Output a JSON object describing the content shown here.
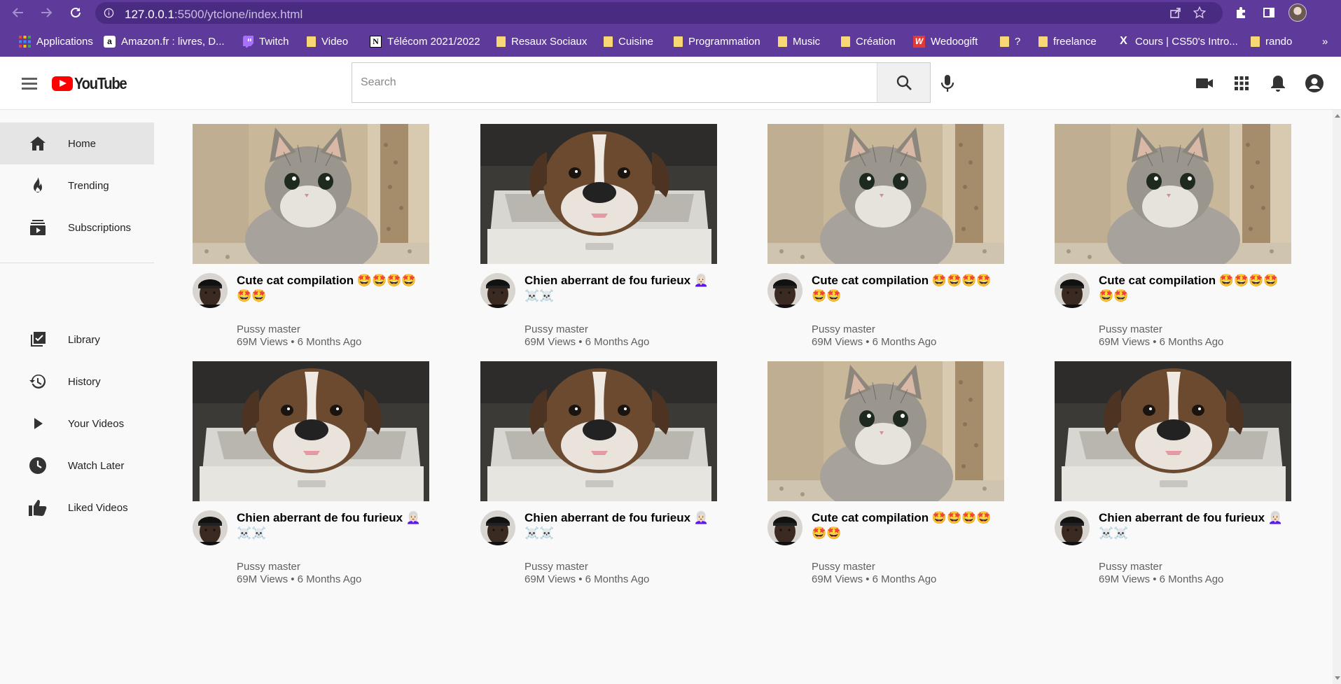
{
  "browser": {
    "url_host": "127.0.0.1",
    "url_rest": ":5500/ytclone/index.html",
    "bookmarks": [
      {
        "label": "Applications",
        "icon": "apps-grid-icon"
      },
      {
        "label": "Amazon.fr : livres, D...",
        "icon": "amazon-icon"
      },
      {
        "label": "Twitch",
        "icon": "twitch-icon"
      },
      {
        "label": "Video",
        "icon": "folder-icon"
      },
      {
        "label": "Télécom 2021/2022",
        "icon": "notion-icon"
      },
      {
        "label": "Resaux Sociaux",
        "icon": "folder-icon"
      },
      {
        "label": "Cuisine",
        "icon": "folder-icon"
      },
      {
        "label": "Programmation",
        "icon": "folder-icon"
      },
      {
        "label": "Music",
        "icon": "folder-icon"
      },
      {
        "label": "Création",
        "icon": "folder-icon"
      },
      {
        "label": "Wedoogift",
        "icon": "wedoogift-icon"
      },
      {
        "label": "?",
        "icon": "folder-icon"
      },
      {
        "label": "freelance",
        "icon": "folder-icon"
      },
      {
        "label": "Cours | CS50's Intro...",
        "icon": "edx-icon"
      },
      {
        "label": "rando",
        "icon": "folder-icon"
      }
    ],
    "more_label": "»"
  },
  "header": {
    "logo_text": "YouTube",
    "search_placeholder": "Search"
  },
  "sidebar": {
    "items": [
      {
        "label": "Home",
        "icon": "home-icon",
        "active": true
      },
      {
        "label": "Trending",
        "icon": "flame-icon"
      },
      {
        "label": "Subscriptions",
        "icon": "subscriptions-icon"
      },
      {
        "label": "Library",
        "icon": "library-icon"
      },
      {
        "label": "History",
        "icon": "history-icon"
      },
      {
        "label": "Your Videos",
        "icon": "play-icon"
      },
      {
        "label": "Watch Later",
        "icon": "clock-icon"
      },
      {
        "label": "Liked Videos",
        "icon": "thumbs-up-icon"
      }
    ]
  },
  "videos": [
    {
      "title": "Cute cat compilation 🤩🤩🤩🤩🤩🤩",
      "thumb": "cat",
      "channel": "Pussy master",
      "meta": "69M Views • 6 Months Ago"
    },
    {
      "title": "Chien aberrant de fou furieux 👩🏻‍🦳☠️☠️",
      "thumb": "dog",
      "channel": "Pussy master",
      "meta": "69M Views • 6 Months Ago"
    },
    {
      "title": "Cute cat compilation 🤩🤩🤩🤩🤩🤩",
      "thumb": "cat",
      "channel": "Pussy master",
      "meta": "69M Views • 6 Months Ago"
    },
    {
      "title": "Cute cat compilation 🤩🤩🤩🤩🤩🤩",
      "thumb": "cat",
      "channel": "Pussy master",
      "meta": "69M Views • 6 Months Ago"
    },
    {
      "title": "Chien aberrant de fou furieux 👩🏻‍🦳☠️☠️",
      "thumb": "dog",
      "channel": "Pussy master",
      "meta": "69M Views • 6 Months Ago"
    },
    {
      "title": "Chien aberrant de fou furieux 👩🏻‍🦳☠️☠️",
      "thumb": "dog",
      "channel": "Pussy master",
      "meta": "69M Views • 6 Months Ago"
    },
    {
      "title": "Cute cat compilation 🤩🤩🤩🤩🤩🤩",
      "thumb": "cat",
      "channel": "Pussy master",
      "meta": "69M Views • 6 Months Ago"
    },
    {
      "title": "Chien aberrant de fou furieux 👩🏻‍🦳☠️☠️",
      "thumb": "dog",
      "channel": "Pussy master",
      "meta": "69M Views • 6 Months Ago"
    }
  ],
  "colors": {
    "chrome_bg": "#5e3a9a",
    "youtube_red": "#ff0000"
  }
}
